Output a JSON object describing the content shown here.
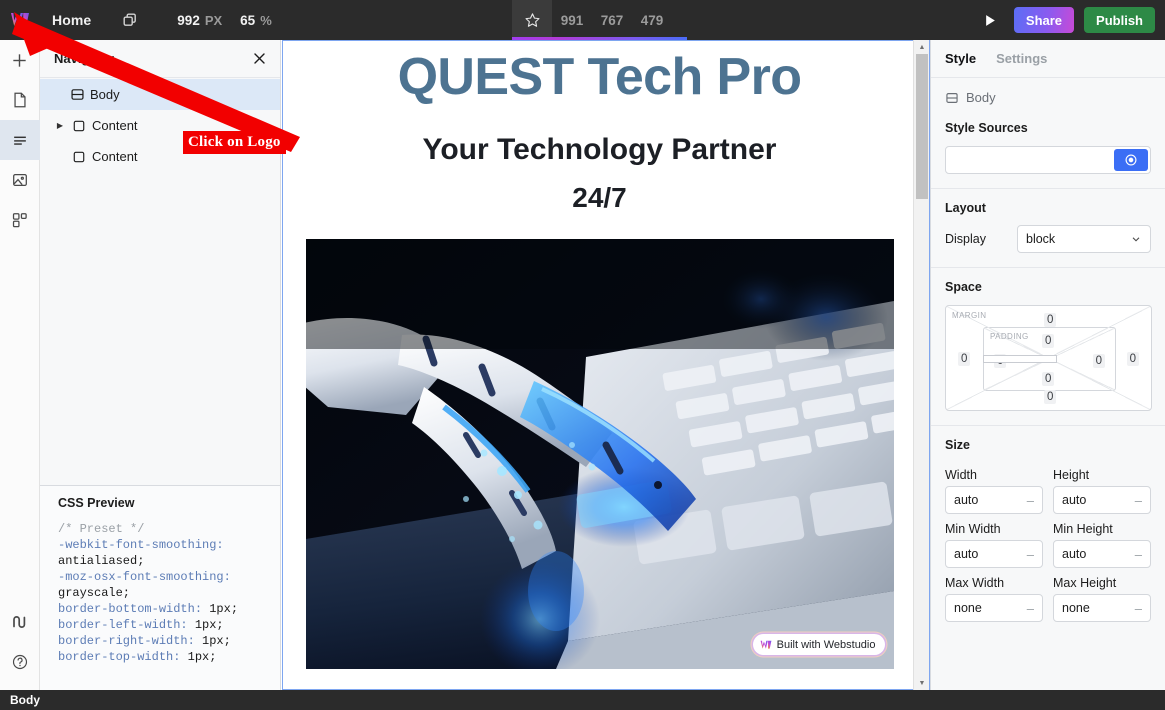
{
  "topbar": {
    "logo_icon": "webstudio-logo-icon",
    "home_label": "Home",
    "duplicate_icon": "copy-icon",
    "width_value": "992",
    "width_unit": "PX",
    "zoom_value": "65",
    "zoom_unit": "%",
    "star_icon": "star-icon",
    "breakpoints": [
      "991",
      "767",
      "479"
    ],
    "play_icon": "play-icon",
    "share_label": "Share",
    "publish_label": "Publish",
    "share_gradient_from": "#5b6ef5",
    "share_gradient_to": "#c84ad6",
    "publish_color": "#2d8a46"
  },
  "rail": {
    "items": [
      {
        "name": "add-icon",
        "glyph": "plus"
      },
      {
        "name": "pages-icon",
        "glyph": "page"
      },
      {
        "name": "navigator-icon",
        "glyph": "lines"
      },
      {
        "name": "assets-icon",
        "glyph": "image"
      },
      {
        "name": "components-icon",
        "glyph": "blocks"
      }
    ],
    "bottom_items": [
      {
        "name": "marketplace-icon",
        "glyph": "wave"
      },
      {
        "name": "help-icon",
        "glyph": "question"
      }
    ]
  },
  "navigator": {
    "title": "Navigator",
    "close_icon": "close-icon",
    "tree": [
      {
        "label": "Body",
        "icon": "body-icon",
        "selected": true,
        "expandable": false,
        "indent": 0
      },
      {
        "label": "Content",
        "icon": "box-icon",
        "selected": false,
        "expandable": true,
        "indent": 1
      },
      {
        "label": "Content",
        "icon": "box-icon",
        "selected": false,
        "expandable": false,
        "indent": 1
      }
    ],
    "css_preview": {
      "title": "CSS Preview",
      "lines": [
        {
          "type": "comment",
          "text": "/* Preset */"
        },
        {
          "type": "prop",
          "text": "-webkit-font-smoothing:"
        },
        {
          "type": "val",
          "text": "antialiased;"
        },
        {
          "type": "prop",
          "text": "-moz-osx-font-smoothing:"
        },
        {
          "type": "val",
          "text": "grayscale;"
        },
        {
          "type": "decl",
          "prop": "border-bottom-width",
          "val": "1px;"
        },
        {
          "type": "decl",
          "prop": "border-left-width",
          "val": "1px;"
        },
        {
          "type": "decl",
          "prop": "border-right-width",
          "val": "1px;"
        },
        {
          "type": "decl",
          "prop": "border-top-width",
          "val": "1px;"
        }
      ]
    }
  },
  "canvas": {
    "heading": "QUEST Tech Pro",
    "subheading": "Your Technology Partner",
    "tagline": "24/7",
    "heading_color": "#4d7391",
    "badge_text": "Built with Webstudio",
    "image_alt": "robot-hand-typing-on-keyboard"
  },
  "inspector": {
    "tabs": [
      {
        "label": "Style",
        "active": true
      },
      {
        "label": "Settings",
        "active": false
      }
    ],
    "selected_element": "Body",
    "style_sources": {
      "title": "Style Sources",
      "input_value": "",
      "input_placeholder": "",
      "add_button_icon": "local-style-icon"
    },
    "layout": {
      "title": "Layout",
      "display_label": "Display",
      "display_value": "block"
    },
    "space": {
      "title": "Space",
      "margin_label": "MARGIN",
      "padding_label": "PADDING",
      "margin_top": "0",
      "margin_right": "0",
      "margin_bottom": "0",
      "margin_left": "0",
      "padding_top": "0",
      "padding_right": "0",
      "padding_bottom": "0",
      "padding_left": "0"
    },
    "size": {
      "title": "Size",
      "fields": [
        {
          "label": "Width",
          "value": "auto"
        },
        {
          "label": "Height",
          "value": "auto"
        },
        {
          "label": "Min Width",
          "value": "auto"
        },
        {
          "label": "Min Height",
          "value": "auto"
        },
        {
          "label": "Max Width",
          "value": "none"
        },
        {
          "label": "Max Height",
          "value": "none"
        }
      ]
    }
  },
  "statusbar": {
    "label": "Body"
  },
  "annotation": {
    "label": "Click on Logo",
    "color": "#f20000"
  }
}
